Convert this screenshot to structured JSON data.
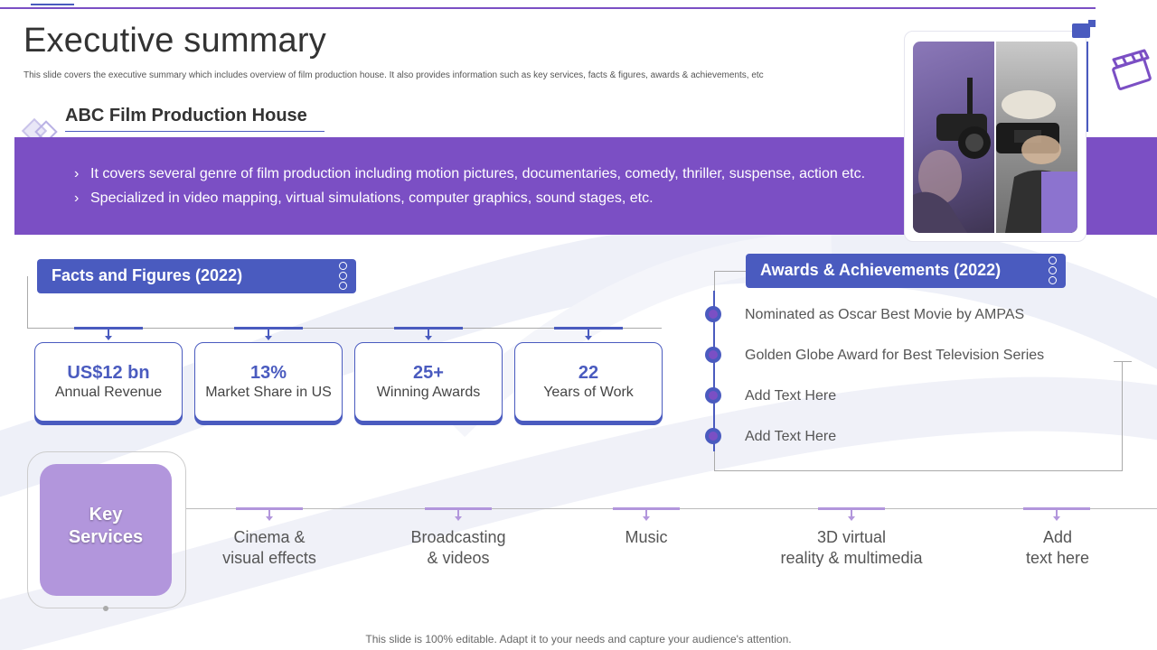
{
  "header": {
    "title": "Executive summary",
    "subtitle": "This slide covers the executive summary which includes overview of film production house. It also provides information such as key services, facts & figures, awards & achievements, etc"
  },
  "company": {
    "name": "ABC Film Production House",
    "points": [
      "It covers several genre of film production including motion pictures, documentaries, comedy, thriller, suspense, action etc.",
      "Specialized in video mapping, virtual simulations, computer graphics, sound stages, etc."
    ]
  },
  "facts": {
    "heading": "Facts and Figures (2022)",
    "items": [
      {
        "value": "US$12 bn",
        "label": "Annual Revenue"
      },
      {
        "value": "13%",
        "label": "Market Share in US"
      },
      {
        "value": "25+",
        "label": "Winning Awards"
      },
      {
        "value": "22",
        "label": "Years of Work"
      }
    ]
  },
  "awards": {
    "heading": "Awards & Achievements (2022)",
    "items": [
      "Nominated as Oscar Best Movie by AMPAS",
      "Golden Globe Award for Best Television Series",
      "Add Text Here",
      "Add Text Here"
    ]
  },
  "services": {
    "heading_line1": "Key",
    "heading_line2": "Services",
    "items": [
      {
        "line1": "Cinema &",
        "line2": "visual effects"
      },
      {
        "line1": "Broadcasting",
        "line2": "& videos"
      },
      {
        "line1": "Music",
        "line2": ""
      },
      {
        "line1": "3D virtual",
        "line2": "reality & multimedia"
      },
      {
        "line1": "Add",
        "line2": "text here"
      }
    ]
  },
  "footer": "This slide is 100% editable. Adapt it to your needs and capture your audience's attention.",
  "colors": {
    "purple": "#7b4fc4",
    "blue": "#4a5bbf",
    "lavender": "#b296dc"
  },
  "icons": {
    "chevron": "›",
    "photo": "film-crew-photo-icon",
    "clapperboard": "clapperboard-icon"
  }
}
